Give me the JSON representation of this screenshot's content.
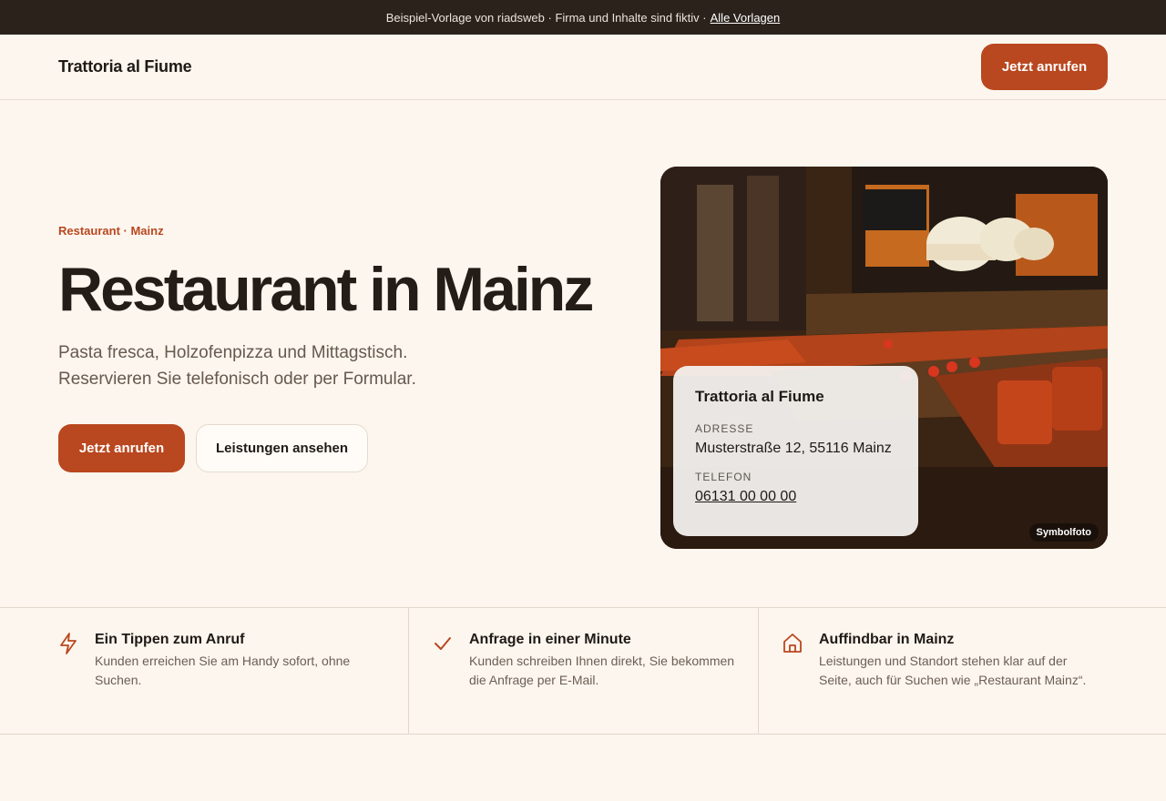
{
  "topbar": {
    "text": "Beispiel-Vorlage von riadsweb · Firma und Inhalte sind fiktiv ·",
    "link": "Alle Vorlagen"
  },
  "header": {
    "brand": "Trattoria al Fiume",
    "cta": "Jetzt anrufen"
  },
  "hero": {
    "eyebrow": "Restaurant · Mainz",
    "title": "Restaurant in Mainz",
    "lead": "Pasta fresca, Holzofenpizza und Mittagstisch. Reservieren Sie telefonisch oder per Formular.",
    "primary": "Jetzt anrufen",
    "secondary": "Leistungen ansehen"
  },
  "card": {
    "name": "Trattoria al Fiume",
    "address_label": "ADRESSE",
    "address": "Musterstraße 12, 55116 Mainz",
    "phone_label": "TELEFON",
    "phone": "06131 00 00 00"
  },
  "photo": {
    "badge": "Symbolfoto"
  },
  "features": [
    {
      "icon": "lightning-icon",
      "title": "Ein Tippen zum Anruf",
      "text": "Kunden erreichen Sie am Handy sofort, ohne Suchen."
    },
    {
      "icon": "checkmark-icon",
      "title": "Anfrage in einer Minute",
      "text": "Kunden schreiben Ihnen direkt, Sie bekommen die Anfrage per E-Mail."
    },
    {
      "icon": "home-icon",
      "title": "Auffindbar in Mainz",
      "text": "Leistungen und Standort stehen klar auf der Seite, auch für Suchen wie „Restaurant Mainz“."
    }
  ],
  "colors": {
    "accent": "#b9471f",
    "background": "#fcf6ee",
    "topbar": "#2b221c"
  }
}
